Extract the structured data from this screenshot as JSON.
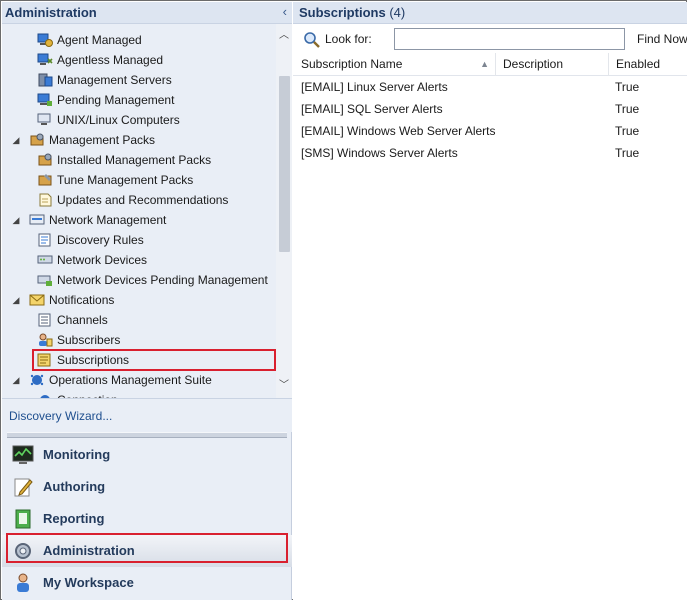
{
  "nav_header": {
    "title": "Administration",
    "collapse_glyph": "‹"
  },
  "tree": [
    {
      "label": "Agent Managed",
      "icon": "agent-managed-icon"
    },
    {
      "label": "Agentless Managed",
      "icon": "agentless-managed-icon"
    },
    {
      "label": "Management Servers",
      "icon": "management-servers-icon"
    },
    {
      "label": "Pending Management",
      "icon": "pending-management-icon"
    },
    {
      "label": "UNIX/Linux Computers",
      "icon": "unix-linux-computers-icon"
    },
    {
      "label": "Management Packs",
      "icon": "management-packs-icon",
      "expanded": true
    },
    {
      "label": "Installed Management Packs",
      "icon": "installed-management-packs-icon"
    },
    {
      "label": "Tune Management Packs",
      "icon": "tune-management-packs-icon"
    },
    {
      "label": "Updates and Recommendations",
      "icon": "updates-recommendations-icon"
    },
    {
      "label": "Network Management",
      "icon": "network-management-icon",
      "expanded": true
    },
    {
      "label": "Discovery Rules",
      "icon": "discovery-rules-icon"
    },
    {
      "label": "Network Devices",
      "icon": "network-devices-icon"
    },
    {
      "label": "Network Devices Pending Management",
      "icon": "network-devices-pending-icon"
    },
    {
      "label": "Notifications",
      "icon": "notifications-icon",
      "expanded": true
    },
    {
      "label": "Channels",
      "icon": "channels-icon"
    },
    {
      "label": "Subscribers",
      "icon": "subscribers-icon"
    },
    {
      "label": "Subscriptions",
      "icon": "subscriptions-icon",
      "selected": true
    },
    {
      "label": "Operations Management Suite",
      "icon": "operations-management-suite-icon",
      "expanded": true
    },
    {
      "label": "Connection",
      "icon": "connection-icon"
    }
  ],
  "wizard_link": "Discovery Wizard...",
  "wunderbar": [
    {
      "label": "Monitoring",
      "icon": "monitoring-icon"
    },
    {
      "label": "Authoring",
      "icon": "authoring-icon"
    },
    {
      "label": "Reporting",
      "icon": "reporting-icon"
    },
    {
      "label": "Administration",
      "icon": "administration-icon",
      "active": true
    },
    {
      "label": "My Workspace",
      "icon": "my-workspace-icon"
    }
  ],
  "content_header": {
    "title": "Subscriptions",
    "count": "(4)"
  },
  "search": {
    "label": "Look for:",
    "value": "",
    "placeholder": "",
    "find_button": "Find Now"
  },
  "table": {
    "columns": [
      "Subscription Name",
      "Description",
      "Enabled"
    ],
    "rows": [
      {
        "name": "[EMAIL] Linux Server Alerts",
        "description": "",
        "enabled": "True"
      },
      {
        "name": "[EMAIL] SQL Server Alerts",
        "description": "",
        "enabled": "True"
      },
      {
        "name": "[EMAIL] Windows Web Server Alerts",
        "description": "",
        "enabled": "True"
      },
      {
        "name": "[SMS] Windows Server Alerts",
        "description": "",
        "enabled": "True"
      }
    ]
  },
  "colors": {
    "highlight_red": "#d9202f",
    "nav_bg": "#e9eef6",
    "header_text": "#1f3a63"
  }
}
